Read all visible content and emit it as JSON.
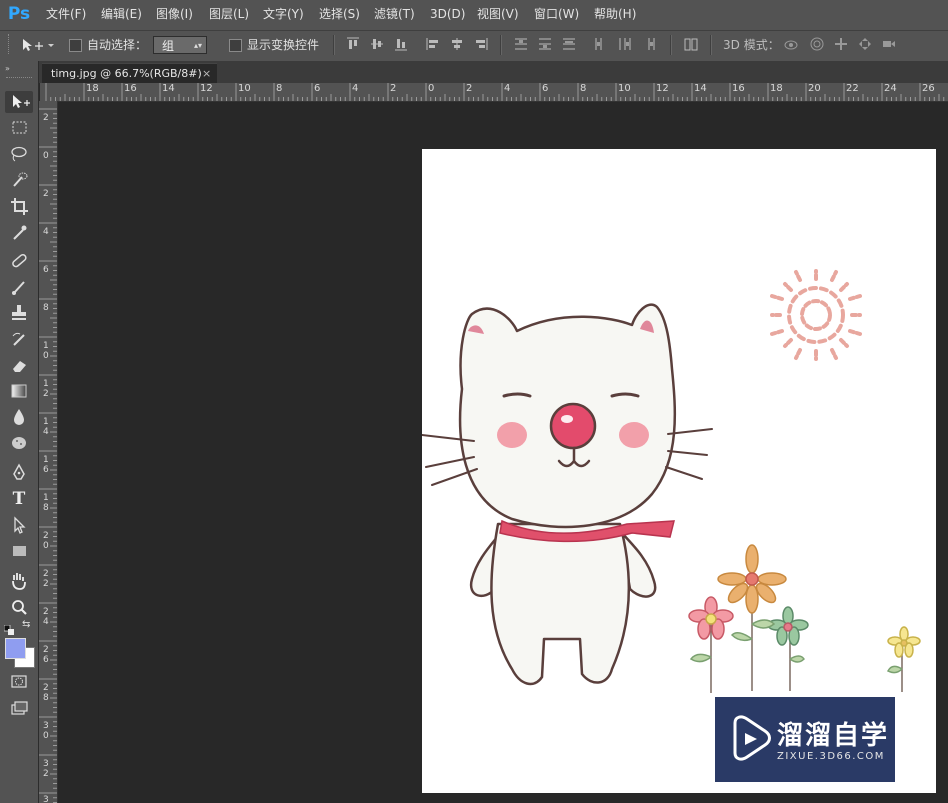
{
  "app": {
    "logo": "Ps"
  },
  "menu": [
    "文件(F)",
    "编辑(E)",
    "图像(I)",
    "图层(L)",
    "文字(Y)",
    "选择(S)",
    "滤镜(T)",
    "3D(D)",
    "视图(V)",
    "窗口(W)",
    "帮助(H)"
  ],
  "options": {
    "auto_select_label": "自动选择：",
    "auto_select_value": "组",
    "show_transform_label": "显示变换控件",
    "mode_3d_label": "3D 模式："
  },
  "document": {
    "tab_title": "timg.jpg @ 66.7%(RGB/8#)",
    "close_glyph": "×"
  },
  "ruler_top": [
    "18",
    "16",
    "14",
    "12",
    "10",
    "8",
    "6",
    "4",
    "2",
    "0",
    "2",
    "4",
    "6",
    "8",
    "10",
    "12",
    "14",
    "16",
    "18",
    "20",
    "22",
    "24",
    "26"
  ],
  "ruler_left": [
    "2",
    "0",
    "2",
    "4",
    "6",
    "8",
    "10",
    "12",
    "14",
    "16",
    "18",
    "20",
    "22",
    "24",
    "26",
    "28",
    "30",
    "32",
    "34"
  ],
  "colors": {
    "foreground": "#8f9df0",
    "background": "#ffffff",
    "accent": "#31a8ff"
  },
  "watermark": {
    "title": "溜溜自学",
    "subtitle": "ZIXUE.3D66.COM"
  }
}
